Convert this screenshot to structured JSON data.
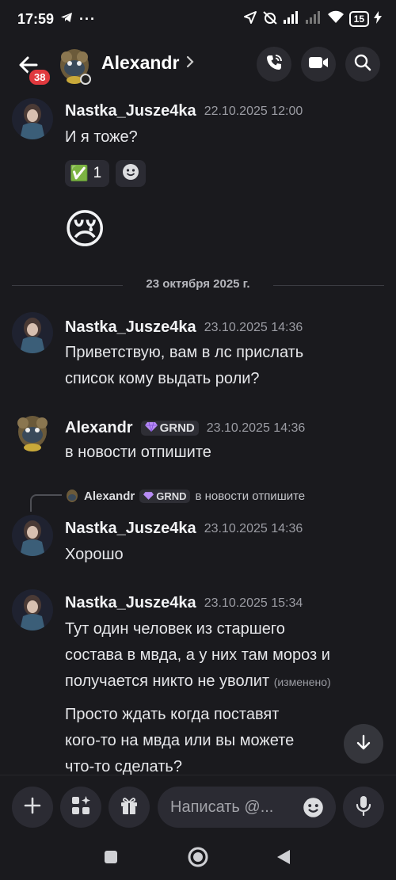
{
  "status_bar": {
    "time": "17:59",
    "battery": "15"
  },
  "header": {
    "badge": "38",
    "title": "Alexandr"
  },
  "messages": [
    {
      "author": "Nastka_Jusze4ka",
      "time": "22.10.2025 12:00",
      "lines": [
        "И я тоже?"
      ],
      "reaction": {
        "emoji": "✅",
        "count": "1"
      },
      "big_emoji": "😢"
    },
    {
      "divider": "23 октября 2025 г."
    },
    {
      "author": "Nastka_Jusze4ka",
      "time": "23.10.2025 14:36",
      "lines": [
        "Приветствую, вам в лс прислать",
        "список кому выдать роли?"
      ]
    },
    {
      "author": "Alexandr",
      "tag": "GRND",
      "time": "23.10.2025 14:36",
      "lines": [
        "в новости отпишите"
      ]
    },
    {
      "reply_to": {
        "author": "Alexandr",
        "tag": "GRND",
        "text": "в новости отпишите"
      },
      "author": "Nastka_Jusze4ka",
      "time": "23.10.2025 14:36",
      "lines": [
        "Хорошо"
      ]
    },
    {
      "author": "Nastka_Jusze4ka",
      "time": "23.10.2025 15:34",
      "lines": [
        "Тут один человек из старшего",
        "состава в мвда, а у них там мороз и",
        "получается никто не уволит"
      ],
      "edited": "(изменено)",
      "lines2": [
        "Просто ждать когда поставят",
        "кого-то на мвда или вы можете",
        "что-то сделать?"
      ]
    }
  ],
  "composer": {
    "placeholder": "Написать @..."
  },
  "icons": {
    "back": "arrow-left-icon",
    "call": "phone-icon",
    "video": "video-camera-icon",
    "search": "search-icon",
    "add": "plus-icon",
    "apps": "apps-sparkle-icon",
    "gift": "gift-icon",
    "emoji": "smiley-icon",
    "mic": "microphone-icon"
  },
  "colors": {
    "background": "#1a1a1e",
    "badge": "#e0393e",
    "surface": "#2b2b33"
  }
}
